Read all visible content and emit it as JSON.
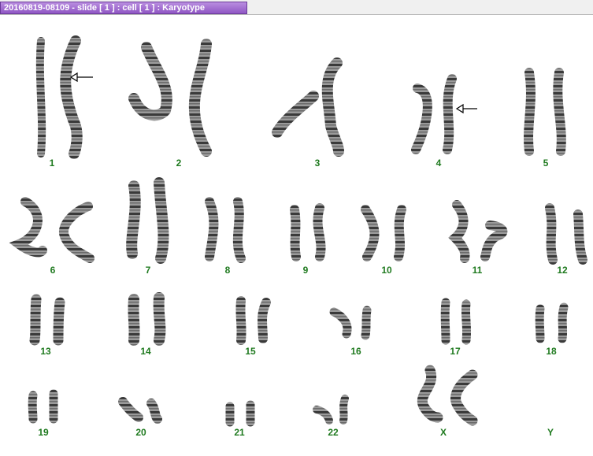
{
  "window": {
    "title": "20160819-08109 - slide [ 1 ] : cell [ 1 ] : Karyotype"
  },
  "colors": {
    "label": "#1f7a1f",
    "title_tab": "#a774d6",
    "chromatid": "#8a8a8a",
    "band": "#2e2e2e"
  },
  "karyotype": {
    "labels": [
      "1",
      "2",
      "3",
      "4",
      "5",
      "6",
      "7",
      "8",
      "9",
      "10",
      "11",
      "12",
      "13",
      "14",
      "15",
      "16",
      "17",
      "18",
      "19",
      "20",
      "21",
      "22",
      "X",
      "Y"
    ]
  },
  "icons": {
    "annotation": "left-arrow-icon"
  }
}
